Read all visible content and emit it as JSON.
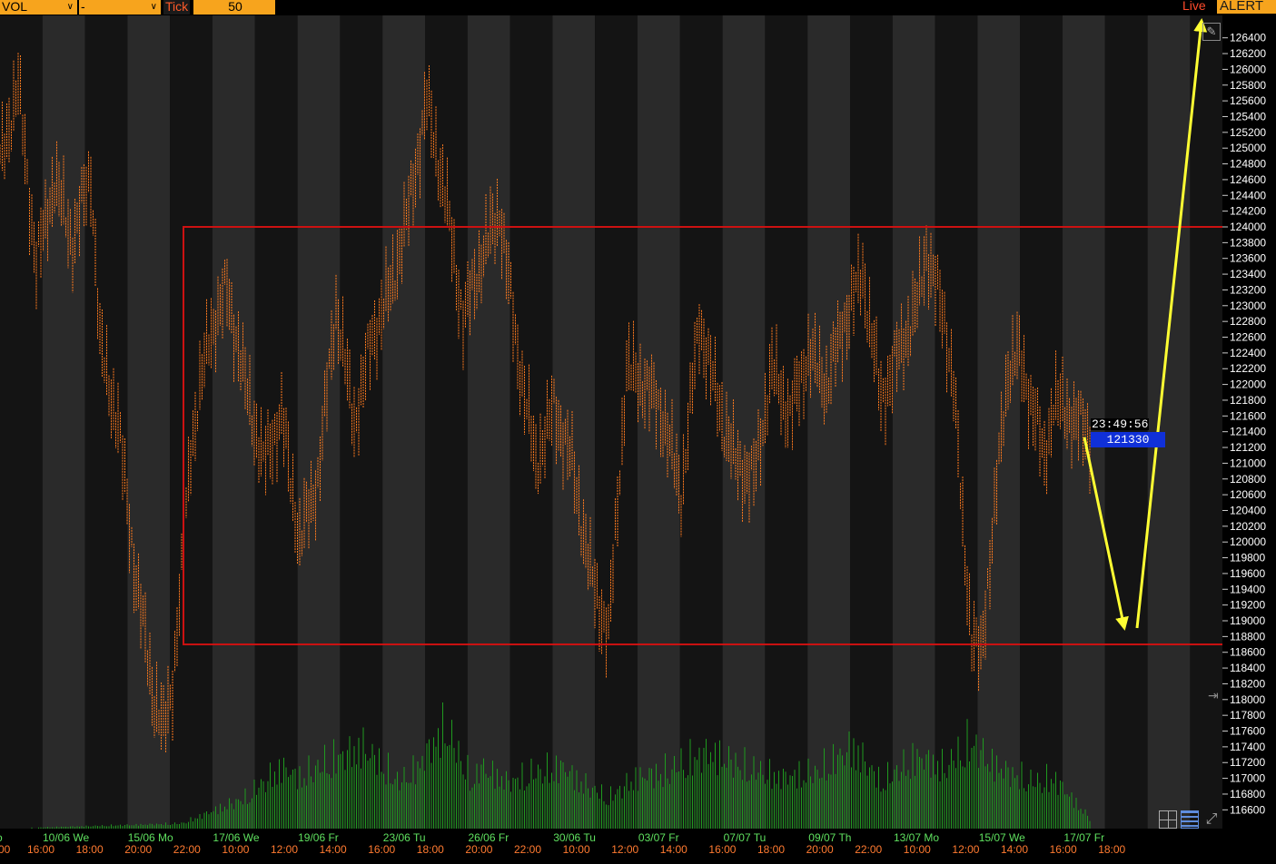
{
  "toolbar": {
    "indicator_select": "VOL",
    "second_select": "-",
    "tick_label": "Tick",
    "tick_value": "50",
    "live_label": "Live",
    "alert_label": "ALERT"
  },
  "colors": {
    "background": "#000000",
    "band_light": "#2a2a2a",
    "bars": "#ff7a1e",
    "volume": "#1f9a1f",
    "range_box": "#cc1111",
    "annotation_arrows": "#ffff33",
    "date_labels": "#5fe05f",
    "time_labels": "#ff7a30",
    "price_tag_bg": "#1030d8",
    "toolbar": "#f7a41d"
  },
  "icons": [
    "pencil-icon",
    "grid-icon",
    "layout-icon",
    "expand-icon",
    "chevron-down-icon"
  ],
  "chart_data": {
    "type": "bar",
    "chart_style": "tick bars with volume histogram",
    "ylim": [
      116500,
      126500
    ],
    "y_ticks": [
      "116600",
      "116800",
      "117000",
      "117200",
      "117400",
      "117600",
      "117800",
      "118000",
      "118200",
      "118400",
      "118600",
      "118800",
      "119000",
      "119200",
      "119400",
      "119600",
      "119800",
      "120000",
      "120200",
      "120400",
      "120600",
      "120800",
      "121000",
      "121200",
      "121400",
      "121600",
      "121800",
      "122000",
      "122200",
      "122400",
      "122600",
      "122800",
      "123000",
      "123200",
      "123400",
      "123600",
      "123800",
      "124000",
      "124200",
      "124400",
      "124600",
      "124800",
      "125000",
      "125200",
      "125400",
      "125600",
      "125800",
      "126000",
      "126200",
      "126400"
    ],
    "x_date_labels": [
      "10/06 We",
      "15/06 Mo",
      "17/06 We",
      "19/06 Fr",
      "23/06 Tu",
      "26/06 Fr",
      "30/06 Tu",
      "03/07 Fr",
      "07/07 Tu",
      "09/07 Th",
      "13/07 Mo",
      "15/07 We",
      "17/07 Fr"
    ],
    "x_time_labels": [
      "16:00",
      "18:00",
      "20:00",
      "22:00",
      "10:00",
      "12:00",
      "14:00",
      "16:00",
      "18:00",
      "20:00",
      "22:00",
      "10:00",
      "12:00",
      "14:00",
      "16:00",
      "18:00",
      "20:00",
      "22:00",
      "10:00",
      "12:00",
      "14:00",
      "16:00",
      "18:00"
    ],
    "first_time_label": "00",
    "partial_left_labels": [
      "o",
      "o"
    ],
    "price_series": {
      "index_range": [
        0,
        120
      ],
      "points": [
        {
          "i": 0,
          "v": 124800
        },
        {
          "i": 2,
          "v": 125800
        },
        {
          "i": 4,
          "v": 123500
        },
        {
          "i": 6,
          "v": 124600
        },
        {
          "i": 8,
          "v": 123800
        },
        {
          "i": 10,
          "v": 124700
        },
        {
          "i": 11,
          "v": 122500
        },
        {
          "i": 13,
          "v": 121500
        },
        {
          "i": 15,
          "v": 119500
        },
        {
          "i": 17,
          "v": 118000
        },
        {
          "i": 18,
          "v": 117600
        },
        {
          "i": 19,
          "v": 118200
        },
        {
          "i": 20,
          "v": 119600
        },
        {
          "i": 21,
          "v": 121200
        },
        {
          "i": 23,
          "v": 122600
        },
        {
          "i": 25,
          "v": 123200
        },
        {
          "i": 27,
          "v": 122000
        },
        {
          "i": 29,
          "v": 121000
        },
        {
          "i": 31,
          "v": 121600
        },
        {
          "i": 33,
          "v": 120000
        },
        {
          "i": 35,
          "v": 120800
        },
        {
          "i": 37,
          "v": 123000
        },
        {
          "i": 39,
          "v": 121500
        },
        {
          "i": 41,
          "v": 122600
        },
        {
          "i": 43,
          "v": 123200
        },
        {
          "i": 45,
          "v": 124200
        },
        {
          "i": 47,
          "v": 125600
        },
        {
          "i": 49,
          "v": 124400
        },
        {
          "i": 51,
          "v": 122800
        },
        {
          "i": 53,
          "v": 123600
        },
        {
          "i": 55,
          "v": 124200
        },
        {
          "i": 57,
          "v": 122400
        },
        {
          "i": 59,
          "v": 121000
        },
        {
          "i": 61,
          "v": 121700
        },
        {
          "i": 63,
          "v": 121000
        },
        {
          "i": 65,
          "v": 119600
        },
        {
          "i": 67,
          "v": 118800
        },
        {
          "i": 69,
          "v": 122200
        },
        {
          "i": 71,
          "v": 122000
        },
        {
          "i": 73,
          "v": 121600
        },
        {
          "i": 75,
          "v": 120600
        },
        {
          "i": 77,
          "v": 122800
        },
        {
          "i": 79,
          "v": 121800
        },
        {
          "i": 81,
          "v": 121000
        },
        {
          "i": 83,
          "v": 120800
        },
        {
          "i": 85,
          "v": 122200
        },
        {
          "i": 87,
          "v": 121600
        },
        {
          "i": 89,
          "v": 122400
        },
        {
          "i": 91,
          "v": 122000
        },
        {
          "i": 93,
          "v": 122800
        },
        {
          "i": 95,
          "v": 123400
        },
        {
          "i": 97,
          "v": 121800
        },
        {
          "i": 99,
          "v": 122400
        },
        {
          "i": 101,
          "v": 123000
        },
        {
          "i": 102,
          "v": 123700
        },
        {
          "i": 104,
          "v": 122800
        },
        {
          "i": 105,
          "v": 122000
        },
        {
          "i": 106,
          "v": 120200
        },
        {
          "i": 107,
          "v": 118800
        },
        {
          "i": 108,
          "v": 118500
        },
        {
          "i": 109,
          "v": 119800
        },
        {
          "i": 110,
          "v": 121000
        },
        {
          "i": 111,
          "v": 122200
        },
        {
          "i": 112,
          "v": 122400
        },
        {
          "i": 114,
          "v": 121600
        },
        {
          "i": 115,
          "v": 121000
        },
        {
          "i": 116,
          "v": 121800
        },
        {
          "i": 118,
          "v": 121600
        },
        {
          "i": 120,
          "v": 121330
        }
      ]
    },
    "volume_series": {
      "note": "relative volume per bar, 0-1",
      "points": [
        {
          "i": 0,
          "v": 0.0
        },
        {
          "i": 20,
          "v": 0.05
        },
        {
          "i": 27,
          "v": 0.3
        },
        {
          "i": 31,
          "v": 0.6
        },
        {
          "i": 33,
          "v": 0.5
        },
        {
          "i": 36,
          "v": 0.65
        },
        {
          "i": 40,
          "v": 0.8
        },
        {
          "i": 44,
          "v": 0.45
        },
        {
          "i": 46,
          "v": 0.6
        },
        {
          "i": 49,
          "v": 1.0
        },
        {
          "i": 52,
          "v": 0.45
        },
        {
          "i": 53,
          "v": 0.6
        },
        {
          "i": 56,
          "v": 0.45
        },
        {
          "i": 59,
          "v": 0.55
        },
        {
          "i": 62,
          "v": 0.6
        },
        {
          "i": 64,
          "v": 0.45
        },
        {
          "i": 67,
          "v": 0.3
        },
        {
          "i": 70,
          "v": 0.5
        },
        {
          "i": 73,
          "v": 0.55
        },
        {
          "i": 78,
          "v": 0.75
        },
        {
          "i": 82,
          "v": 0.6
        },
        {
          "i": 86,
          "v": 0.5
        },
        {
          "i": 90,
          "v": 0.55
        },
        {
          "i": 94,
          "v": 0.8
        },
        {
          "i": 97,
          "v": 0.45
        },
        {
          "i": 101,
          "v": 0.7
        },
        {
          "i": 104,
          "v": 0.6
        },
        {
          "i": 107,
          "v": 0.85
        },
        {
          "i": 109,
          "v": 0.65
        },
        {
          "i": 111,
          "v": 0.55
        },
        {
          "i": 114,
          "v": 0.45
        },
        {
          "i": 116,
          "v": 0.5
        },
        {
          "i": 118,
          "v": 0.3
        },
        {
          "i": 120,
          "v": 0.1
        }
      ]
    },
    "range_box": {
      "y_top": 124000,
      "y_bottom": 118700,
      "start_date": "15/06 Mo"
    },
    "last_price": {
      "value": 121330,
      "label": "121330",
      "time": "23:49:56"
    },
    "annotation_arrows": [
      {
        "from_value": 121330,
        "to_value": 119000
      },
      {
        "from_value": 119000,
        "to_value": 126500
      }
    ]
  }
}
